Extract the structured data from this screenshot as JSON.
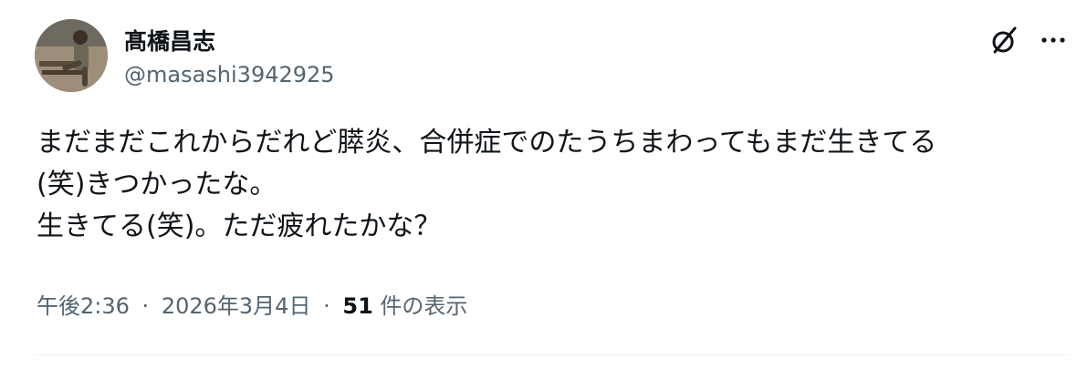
{
  "author": {
    "display_name": "髙橋昌志",
    "handle": "@masashi3942925"
  },
  "tweet": {
    "lines": [
      "まだまだこれからだれど膵炎、合併症でのたうちまわってもまだ生きてる",
      "(笑)きつかったな。",
      "生きてる(笑)。ただ疲れたかな？"
    ]
  },
  "meta": {
    "time": "午後2:36",
    "separator": "·",
    "date": "2026年3月4日",
    "views_count": "51",
    "views_label": "件の表示"
  },
  "icons": {
    "grok": "grok-icon",
    "more": "more-options-icon"
  },
  "colors": {
    "text_primary": "#0f1419",
    "text_secondary": "#536471",
    "divider": "#eff3f4"
  }
}
